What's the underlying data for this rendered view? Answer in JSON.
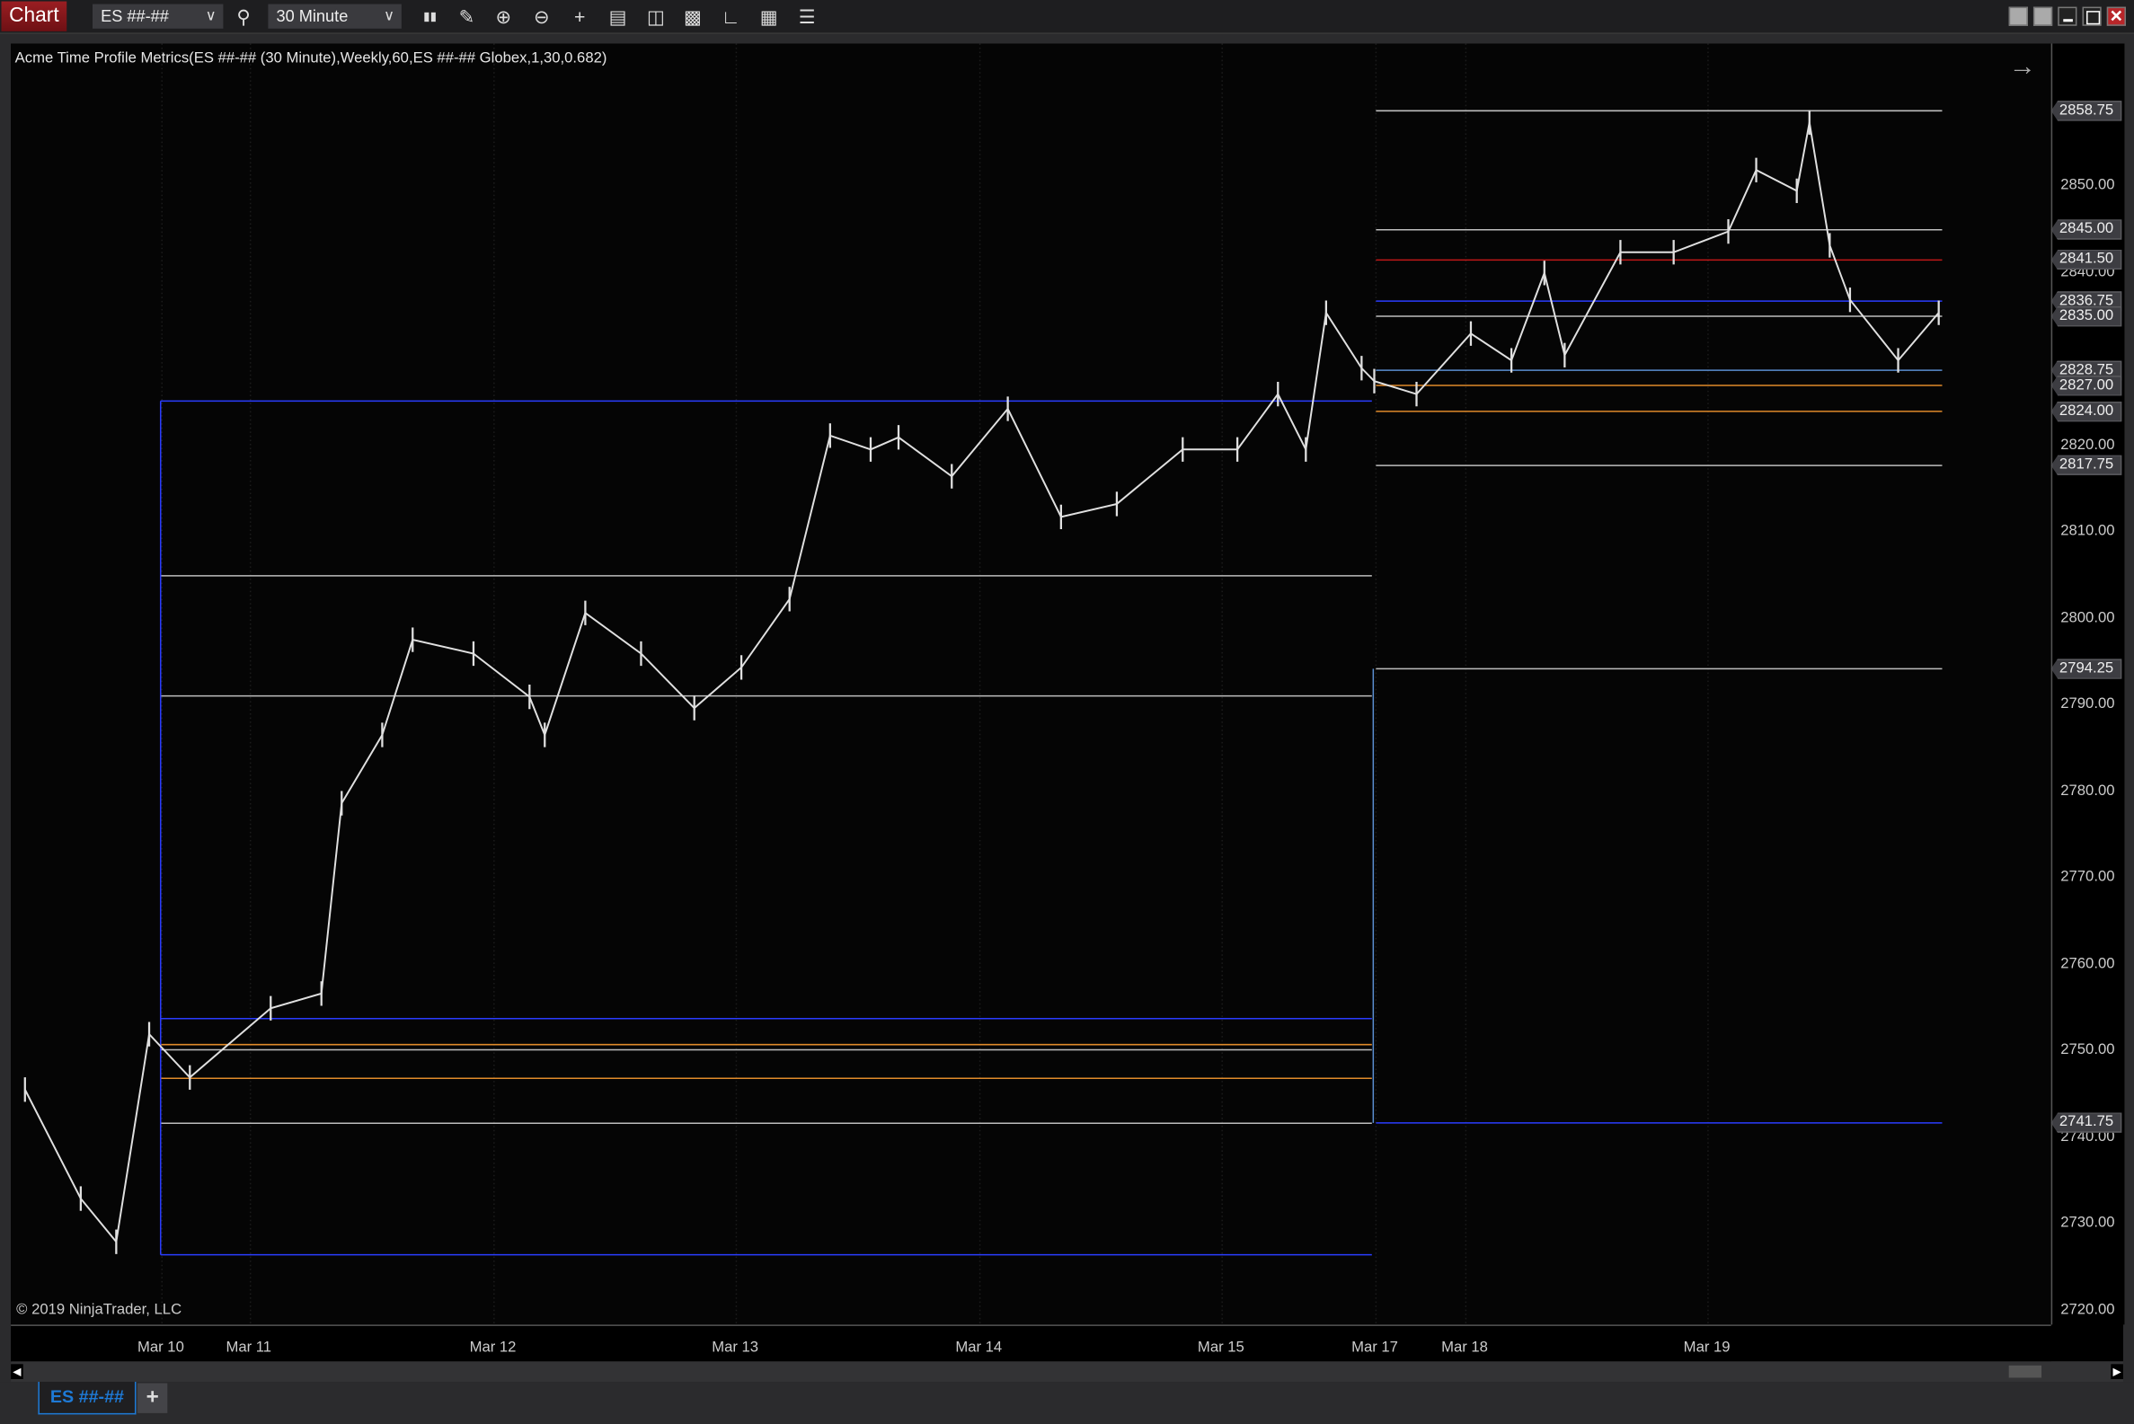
{
  "toolbar": {
    "chart_label": "Chart",
    "instrument": "ES ##-##",
    "interval": "30 Minute",
    "icons": [
      "bar-type-icon",
      "drawing-tool-icon",
      "zoom-in-icon",
      "zoom-out-icon",
      "crosshair-icon",
      "data-box-icon",
      "indicators-icon",
      "strategies-icon",
      "chart-trader-icon",
      "properties-icon",
      "list-icon"
    ],
    "window_buttons": [
      "tile-button",
      "tile-button",
      "minimize-button",
      "maximize-button",
      "close-button"
    ]
  },
  "indicator_title": "Acme Time Profile Metrics(ES ##-## (30 Minute),Weekly,60,ES ##-## Globex,1,30,0.682)",
  "copyright": "© 2019 NinjaTrader, LLC",
  "tabs": [
    {
      "label": "ES ##-##",
      "active": true
    }
  ],
  "add_tab_label": "+",
  "colors": {
    "background": "#050505",
    "price": "#e0e0e0",
    "blue": "#2a3cff",
    "orange": "#e08a2a",
    "red": "#c01818",
    "gray": "#bdbdbd",
    "steel": "#5a8ed0"
  },
  "chart_data": {
    "type": "line",
    "x_tick_labels": [
      "Mar 10",
      "Mar 11",
      "Mar 12",
      "Mar 13",
      "Mar 14",
      "Mar 15",
      "Mar 17",
      "Mar 18",
      "Mar 19"
    ],
    "y_tick_labels": [
      "2850.00",
      "2840.00",
      "2820.00",
      "2810.00",
      "2800.00",
      "2790.00",
      "2780.00",
      "2770.00",
      "2760.00",
      "2750.00",
      "2740.00",
      "2730.00",
      "2720.00"
    ],
    "ylim": [
      2720,
      2860
    ],
    "price_series": [
      [
        "Mar 8 03:00",
        2745.6
      ],
      [
        "Mar 8 08:30",
        2733
      ],
      [
        "Mar 8 12:00",
        2728
      ],
      [
        "Mar 8 15:15",
        2752
      ],
      [
        "Mar 10 02:45",
        2747
      ],
      [
        "Mar 11 02:00",
        2755
      ],
      [
        "Mar 11 07:00",
        2756.7
      ],
      [
        "Mar 11 09:00",
        2778.7
      ],
      [
        "Mar 11 13:00",
        2786.6
      ],
      [
        "Mar 11 16:00",
        2797.6
      ],
      [
        "Mar 11 22:00",
        2796
      ],
      [
        "Mar 12 03:30",
        2791
      ],
      [
        "Mar 12 05:00",
        2786.6
      ],
      [
        "Mar 12 09:00",
        2800.7
      ],
      [
        "Mar 12 14:30",
        2796
      ],
      [
        "Mar 12 19:45",
        2789.7
      ],
      [
        "Mar 13 00:30",
        2794.4
      ],
      [
        "Mar 13 05:15",
        2802.3
      ],
      [
        "Mar 13 09:15",
        2821.2
      ],
      [
        "Mar 13 13:15",
        2819.6
      ],
      [
        "Mar 13 16:00",
        2821
      ],
      [
        "Mar 13 21:15",
        2816.5
      ],
      [
        "Mar 14 02:45",
        2824.3
      ],
      [
        "Mar 14 08:00",
        2811.8
      ],
      [
        "Mar 14 13:30",
        2813.3
      ],
      [
        "Mar 14 20:00",
        2819.6
      ],
      [
        "Mar 15 01:30",
        2819.6
      ],
      [
        "Mar 15 05:30",
        2826
      ],
      [
        "Mar 15 08:15",
        2819.6
      ],
      [
        "Mar 15 10:15",
        2835.4
      ],
      [
        "Mar 15 13:45",
        2829
      ],
      [
        "Mar 15 15:00",
        2827.5
      ],
      [
        "Mar 17 04:00",
        2826
      ],
      [
        "Mar 18 00:30",
        2833
      ],
      [
        "Mar 18 04:30",
        2829.9
      ],
      [
        "Mar 18 07:45",
        2840
      ],
      [
        "Mar 18 09:45",
        2830.5
      ],
      [
        "Mar 18 15:15",
        2842.4
      ],
      [
        "Mar 18 20:30",
        2842.4
      ],
      [
        "Mar 19 02:00",
        2844.8
      ],
      [
        "Mar 19 04:45",
        2851.9
      ],
      [
        "Mar 19 08:45",
        2849.5
      ],
      [
        "Mar 19 10:00",
        2857.4
      ],
      [
        "Mar 19 12:00",
        2843.2
      ],
      [
        "Mar 19 14:00",
        2836.9
      ],
      [
        "Mar 19 18:45",
        2829.9
      ],
      [
        "Mar 19 22:45",
        2835.4
      ]
    ],
    "prior_week_levels": [
      {
        "price": 2825.2,
        "color": "#2a3cff"
      },
      {
        "price": 2805,
        "color": "#bdbdbd"
      },
      {
        "price": 2791.1,
        "color": "#bdbdbd"
      },
      {
        "price": 2753.8,
        "color": "#2a3cff"
      },
      {
        "price": 2750.8,
        "color": "#e08a2a"
      },
      {
        "price": 2750.2,
        "color": "#bdbdbd"
      },
      {
        "price": 2746.9,
        "color": "#e08a2a"
      },
      {
        "price": 2741.7,
        "color": "#bdbdbd"
      },
      {
        "price": 2726.5,
        "color": "#2a3cff"
      }
    ],
    "current_levels": [
      {
        "price": 2858.75,
        "label": "2858.75",
        "color": "#bdbdbd"
      },
      {
        "price": 2845.0,
        "label": "2845.00",
        "color": "#bdbdbd"
      },
      {
        "price": 2841.5,
        "label": "2841.50",
        "color": "#c01818"
      },
      {
        "price": 2836.75,
        "label": "2836.75",
        "color": "#2a3cff"
      },
      {
        "price": 2835.0,
        "label": "2835.00",
        "color": "#bdbdbd"
      },
      {
        "price": 2828.75,
        "label": "2828.75",
        "color": "#5a8ed0"
      },
      {
        "price": 2827.0,
        "label": "2827.00",
        "color": "#e08a2a"
      },
      {
        "price": 2824.0,
        "label": "2824.00",
        "color": "#e08a2a"
      },
      {
        "price": 2817.75,
        "label": "2817.75",
        "color": "#bdbdbd"
      },
      {
        "price": 2794.25,
        "label": "2794.25",
        "color": "#bdbdbd"
      },
      {
        "price": 2741.75,
        "label": "2741.75",
        "color": "#2a3cff"
      }
    ]
  }
}
